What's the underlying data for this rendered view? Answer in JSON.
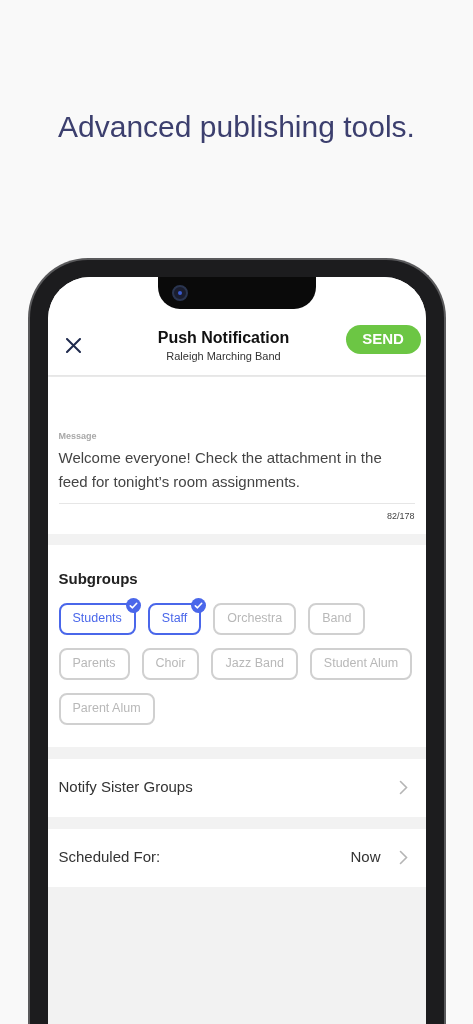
{
  "headline": "Advanced publishing tools.",
  "header": {
    "title": "Push Notification",
    "subtitle": "Raleigh Marching Band",
    "send_button": "SEND"
  },
  "message": {
    "label": "Message",
    "value": "Welcome everyone! Check the attachment in the feed for tonight’s room assignments.",
    "counter": "82/178"
  },
  "subgroups": {
    "title": "Subgroups",
    "items": [
      {
        "label": "Students",
        "selected": true
      },
      {
        "label": "Staff",
        "selected": true
      },
      {
        "label": "Orchestra",
        "selected": false
      },
      {
        "label": "Band",
        "selected": false
      },
      {
        "label": "Parents",
        "selected": false
      },
      {
        "label": "Choir",
        "selected": false
      },
      {
        "label": "Jazz Band",
        "selected": false
      },
      {
        "label": "Student Alum",
        "selected": false
      },
      {
        "label": "Parent Alum",
        "selected": false
      }
    ]
  },
  "rows": [
    {
      "label": "Notify Sister Groups"
    },
    {
      "label": "Scheduled For:",
      "value": "Now"
    }
  ]
}
